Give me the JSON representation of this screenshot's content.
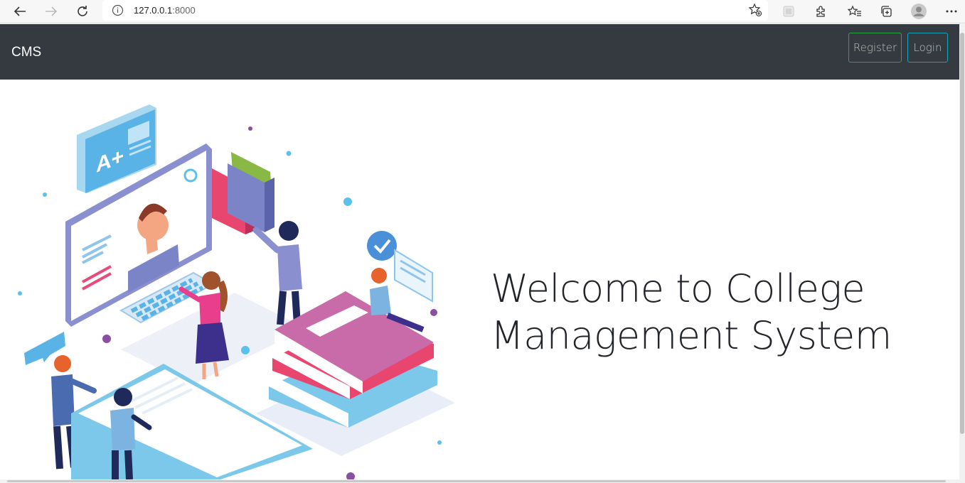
{
  "browser": {
    "url_host": "127.0.0.1",
    "url_port": ":8000"
  },
  "navbar": {
    "brand": "CMS",
    "register_label": "Register",
    "login_label": "Login"
  },
  "hero": {
    "line1": "Welcome to College",
    "line2": "Management System",
    "badge_text": "A+"
  },
  "colors": {
    "navbar_bg": "#343a40",
    "register_border": "#28a745",
    "login_border": "#17a2b8"
  }
}
